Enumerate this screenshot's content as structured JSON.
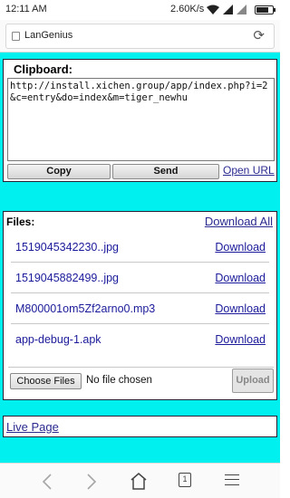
{
  "status": {
    "time": "12:11 AM",
    "speed": "2.60K/s",
    "battery_level": 0.75
  },
  "browser": {
    "site_name": "LanGenius",
    "page_icon": "page-icon",
    "reload_icon": "reload-icon"
  },
  "clipboard": {
    "title": "Clipboard:",
    "text": "http://install.xichen.group/app/index.php?i=2&c=entry&do=index&m=tiger_newhu",
    "copy_label": "Copy",
    "send_label": "Send",
    "open_url_label": "Open URL"
  },
  "files": {
    "title": "Files:",
    "download_all_label": "Download All",
    "items": [
      {
        "name": "1519045342230..jpg",
        "download_label": "Download"
      },
      {
        "name": "1519045882499..jpg",
        "download_label": "Download"
      },
      {
        "name": "M800001om5Zf2arno0.mp3",
        "download_label": "Download"
      },
      {
        "name": "app-debug-1.apk",
        "download_label": "Download"
      }
    ],
    "choose_files_label": "Choose Files",
    "no_file_text": "No file chosen",
    "upload_label": "Upload"
  },
  "live_page_label": "Live Page",
  "navbar": {
    "back_icon": "back-arrow-icon",
    "forward_icon": "forward-arrow-icon",
    "home_icon": "home-icon",
    "tab_count": "1",
    "menu_icon": "menu-icon"
  },
  "colors": {
    "page_background": "#00f0f0",
    "link": "#1a1a9a"
  }
}
